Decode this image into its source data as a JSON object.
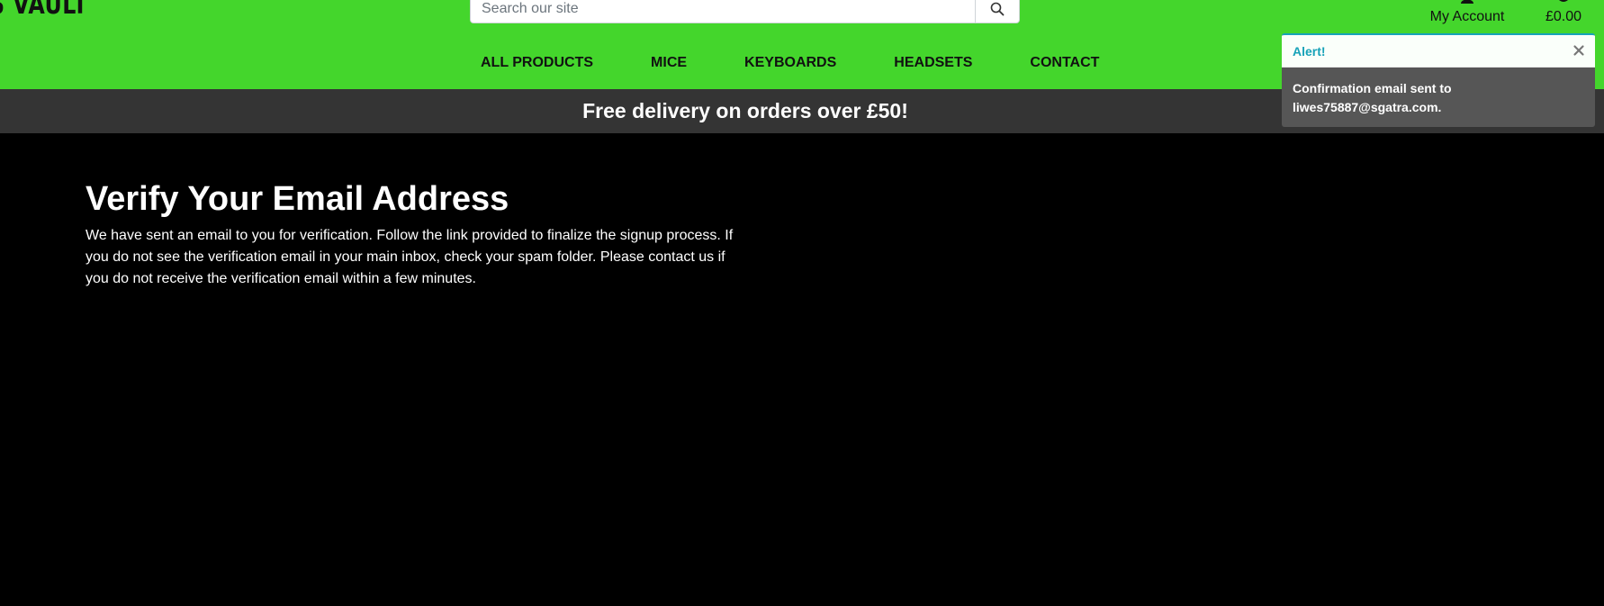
{
  "header": {
    "logo_text": "S VAULT",
    "search": {
      "placeholder": "Search our site",
      "value": ""
    },
    "account_label": "My Account",
    "cart_total": "£0.00",
    "icons": {
      "search": "search-icon",
      "account": "user-icon",
      "cart": "shopping-bag-icon"
    },
    "background_color": "#44d62c"
  },
  "nav": {
    "items": [
      {
        "label": "ALL PRODUCTS"
      },
      {
        "label": "MICE"
      },
      {
        "label": "KEYBOARDS"
      },
      {
        "label": "HEADSETS"
      },
      {
        "label": "CONTACT"
      }
    ]
  },
  "promo": {
    "text": "Free delivery on orders over £50!",
    "background_color": "#343434"
  },
  "main": {
    "title": "Verify Your Email Address",
    "body": "We have sent an email to you for verification. Follow the link provided to finalize the signup process. If you do not see the verification email in your main inbox, check your spam folder. Please contact us if you do not receive the verification email within a few minutes."
  },
  "toast": {
    "title": "Alert!",
    "message": "Confirmation email sent to liwes75887@sgatra.com.",
    "close_icon": "close-icon",
    "accent_color": "#17a2b8"
  }
}
